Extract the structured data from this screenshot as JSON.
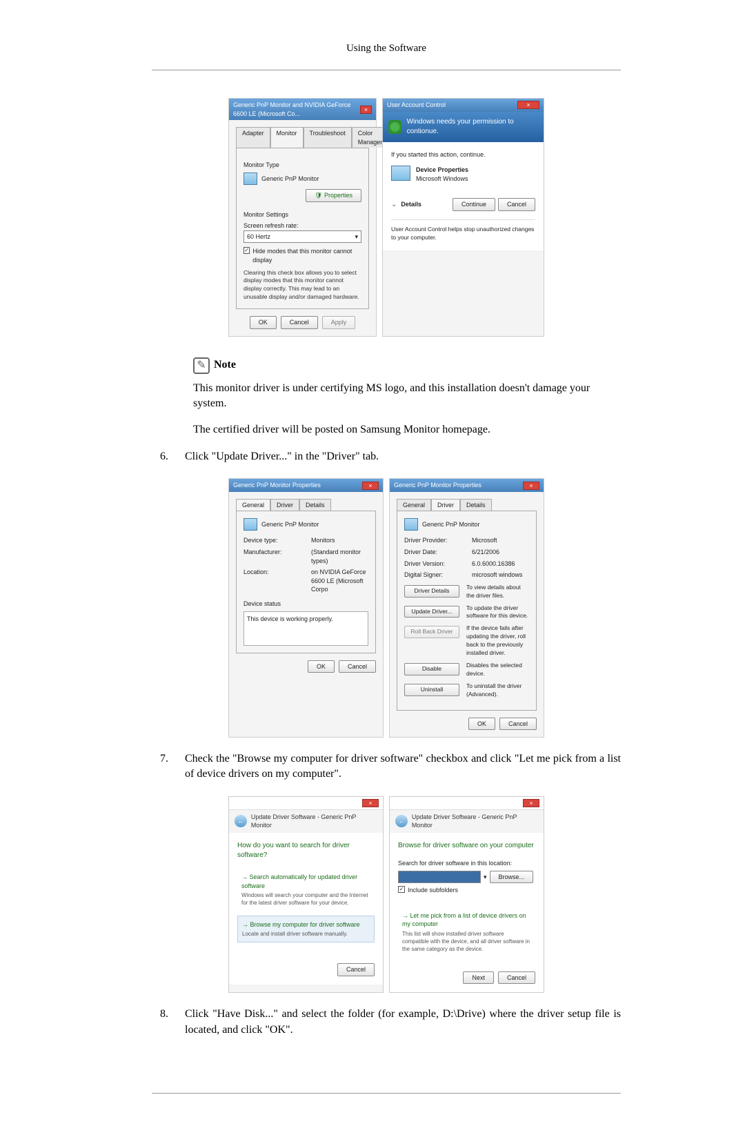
{
  "header": "Using the Software",
  "dialog1": {
    "title": "Generic PnP Monitor and NVIDIA GeForce 6600 LE (Microsoft Co...",
    "tabs": [
      "Adapter",
      "Monitor",
      "Troubleshoot",
      "Color Management"
    ],
    "monitor_type_label": "Monitor Type",
    "monitor_name": "Generic PnP Monitor",
    "properties_btn": "Properties",
    "monitor_settings_label": "Monitor Settings",
    "refresh_label": "Screen refresh rate:",
    "refresh_value": "60 Hertz",
    "hide_modes": "Hide modes that this monitor cannot display",
    "hide_modes_note": "Clearing this check box allows you to select display modes that this monitor cannot display correctly. This may lead to an unusable display and/or damaged hardware.",
    "ok": "OK",
    "cancel": "Cancel",
    "apply": "Apply"
  },
  "uac": {
    "title": "User Account Control",
    "banner": "Windows needs your permission to contionue.",
    "started": "If you started this action, continue.",
    "program_name": "Device Properties",
    "program_vendor": "Microsoft Windows",
    "details": "Details",
    "continue": "Continue",
    "cancel": "Cancel",
    "footer": "User Account Control helps stop unauthorized changes to your computer."
  },
  "note_label": "Note",
  "note_para1": "This monitor driver is under certifying MS logo, and this installation doesn't damage your system.",
  "note_para2": "The certified driver will be posted on Samsung Monitor homepage.",
  "step6": {
    "num": "6.",
    "text": "Click \"Update Driver...\" in the \"Driver\" tab."
  },
  "props_general": {
    "title": "Generic PnP Monitor Properties",
    "tabs": [
      "General",
      "Driver",
      "Details"
    ],
    "monitor_name": "Generic PnP Monitor",
    "device_type_label": "Device type:",
    "device_type": "Monitors",
    "manufacturer_label": "Manufacturer:",
    "manufacturer": "(Standard monitor types)",
    "location_label": "Location:",
    "location": "on NVIDIA GeForce 6600 LE (Microsoft Corpo",
    "device_status_label": "Device status",
    "device_status": "This device is working properly.",
    "ok": "OK",
    "cancel": "Cancel"
  },
  "props_driver": {
    "title": "Generic PnP Monitor Properties",
    "tabs": [
      "General",
      "Driver",
      "Details"
    ],
    "monitor_name": "Generic PnP Monitor",
    "provider_label": "Driver Provider:",
    "provider": "Microsoft",
    "date_label": "Driver Date:",
    "date": "6/21/2006",
    "version_label": "Driver Version:",
    "version": "6.0.6000.16386",
    "signer_label": "Digital Signer:",
    "signer": "microsoft windows",
    "btn_details": "Driver Details",
    "desc_details": "To view details about the driver files.",
    "btn_update": "Update Driver...",
    "desc_update": "To update the driver software for this device.",
    "btn_rollback": "Roll Back Driver",
    "desc_rollback": "If the device fails after updating the driver, roll back to the previously installed driver.",
    "btn_disable": "Disable",
    "desc_disable": "Disables the selected device.",
    "btn_uninstall": "Uninstall",
    "desc_uninstall": "To uninstall the driver (Advanced).",
    "ok": "OK",
    "cancel": "Cancel"
  },
  "step7": {
    "num": "7.",
    "text": "Check the \"Browse my computer for driver software\" checkbox and click \"Let me pick from a list of device drivers on my computer\"."
  },
  "wizard1": {
    "breadcrumb": "Update Driver Software - Generic PnP Monitor",
    "title": "How do you want to search for driver software?",
    "opt1_title": "Search automatically for updated driver software",
    "opt1_desc": "Windows will search your computer and the Internet for the latest driver software for your device.",
    "opt2_title": "Browse my computer for driver software",
    "opt2_desc": "Locate and install driver software manually.",
    "cancel": "Cancel"
  },
  "wizard2": {
    "breadcrumb": "Update Driver Software - Generic PnP Monitor",
    "title": "Browse for driver software on your computer",
    "search_label": "Search for driver software in this location:",
    "browse_btn": "Browse...",
    "include_sub": "Include subfolders",
    "opt_title": "Let me pick from a list of device drivers on my computer",
    "opt_desc": "This list will show installed driver software compatible with the device, and all driver software in the same category as the device.",
    "next": "Next",
    "cancel": "Cancel"
  },
  "step8": {
    "num": "8.",
    "text": "Click \"Have Disk...\" and select the folder (for example, D:\\Drive) where the driver setup file is located, and click \"OK\"."
  }
}
